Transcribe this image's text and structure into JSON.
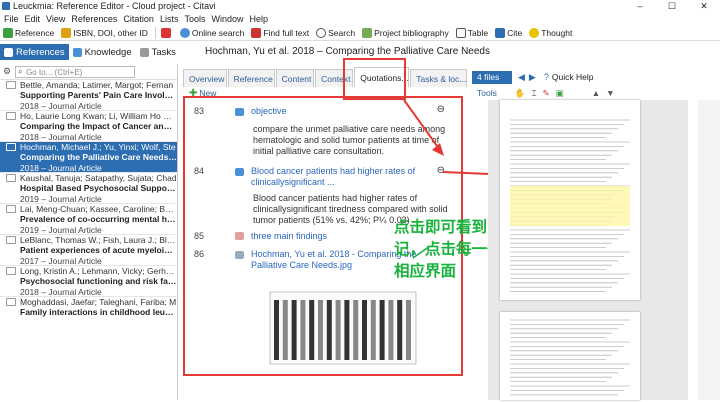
{
  "window": {
    "title": "Leuckmia: Reference Editor - Cloud project - Citavi",
    "controls": [
      "–",
      "☐",
      "✕"
    ]
  },
  "menu": [
    "File",
    "Edit",
    "View",
    "References",
    "Citation",
    "Lists",
    "Tools",
    "Window",
    "Help"
  ],
  "toolbar": {
    "reference": "Reference",
    "isbn": "ISBN, DOI, other ID",
    "online_search": "Online search",
    "find_full_text": "Find full text",
    "search": "Search",
    "project_bibliography": "Project bibliography",
    "table": "Table",
    "cite": "Cite",
    "thought": "Thought"
  },
  "modes": {
    "references": "References",
    "knowledge": "Knowledge",
    "tasks": "Tasks"
  },
  "doc_header": "Hochman, Yu et al. 2018 – Comparing the Palliative Care Needs",
  "left": {
    "search_placeholder": "Go to... (Ctrl+E)",
    "items": [
      {
        "authors": "Bettle, Amanda; Latimer, Margot; Fernan",
        "title": "Supporting Parents' Pain Care Involvem",
        "meta": "2018 – Journal Article"
      },
      {
        "authors": "Ho, Laurie Long Kwan; Li, William Ho Che",
        "title": "Comparing the Impact of Cancer and Tre",
        "meta": "2018 – Journal Article"
      },
      {
        "authors": "Hochman, Michael J.; Yu, Yinxi; Wolf, Ste",
        "title": "Comparing the Palliative Care Needs of",
        "meta": "2018 – Journal Article"
      },
      {
        "authors": "Kaushal, Tanuja; Satapathy, Sujata; Chad",
        "title": "Hospital Based Psychosocial Support Pr",
        "meta": "2019 – Journal Article"
      },
      {
        "authors": "Lai, Meng-Chuan; Kassee, Caroline; Besn",
        "title": "Prevalence of co-occurring mental healt",
        "meta": "2019 – Journal Article"
      },
      {
        "authors": "LeBlanc, Thomas W.; Fish, Laura J.; Bloom",
        "title": "Patient experiences of acute myeloid leu",
        "meta": "2017 – Journal Article"
      },
      {
        "authors": "Long, Kristin A.; Lehmann, Vicky; Gerhard",
        "title": "Psychosocial functioning and risk factors",
        "meta": "2018 – Journal Article"
      },
      {
        "authors": "Moghaddasi, Jaefar; Taleghani, Fariba; M",
        "title": "Family interactions in childhood leukemi",
        "meta": ""
      }
    ]
  },
  "tabs": [
    "Overview",
    "Reference",
    "Content",
    "Context",
    "Quotations...",
    "Tasks & loc..."
  ],
  "new_label": "New",
  "quotes": [
    {
      "num": "83",
      "title": "objective",
      "body": [
        "compare the unmet palliative care needs among",
        "hematologic and solid tumor patients at time of",
        "initial palliative care consultation."
      ]
    },
    {
      "num": "84",
      "title": "Blood cancer patients had higher rates of",
      "title2": "clinicallysignificant ...",
      "body": [
        "Blood cancer patients had higher rates of",
        "clinicallysignificant tiredness compared with solid",
        "tumor patients (51% vs. 42%; P¼ 0.03)"
      ]
    },
    {
      "num": "85",
      "title": "three main findings",
      "body": []
    },
    {
      "num": "86",
      "title": "Hochman, Yu et al. 2018 - Comparing the",
      "title2": "Palliative Care Needs.jpg",
      "body": []
    }
  ],
  "annotation": {
    "line1": "点击即可看到自己所做的笔",
    "line2": "记，点击每一条即可跳转到",
    "line3": "相应界面"
  },
  "right": {
    "files": "4 files",
    "quick_help": "Quick Help",
    "tools": "Tools"
  },
  "colors": {
    "accent": "#2d6db2",
    "highlight_red": "#e53935",
    "note_green": "#19b23c"
  }
}
